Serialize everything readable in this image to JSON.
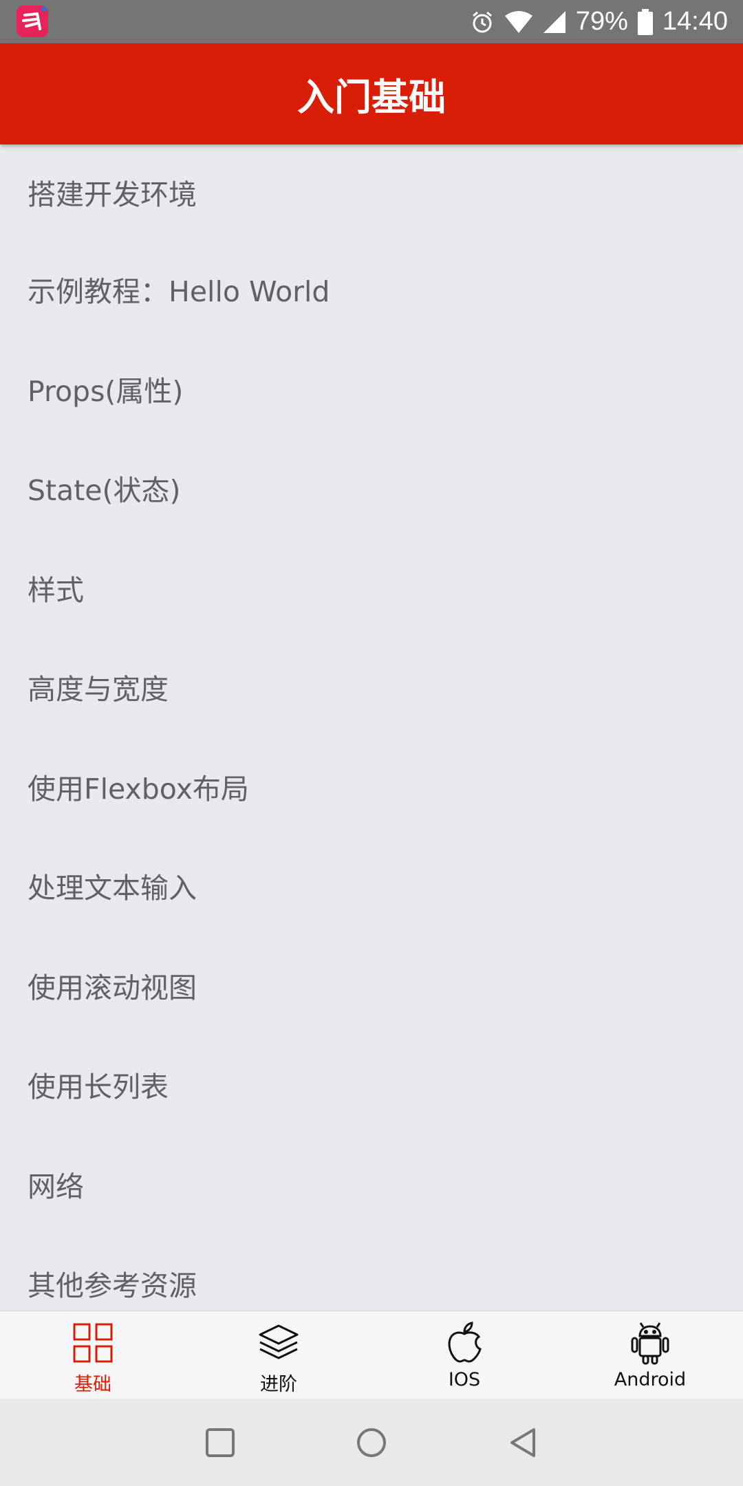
{
  "status_bar": {
    "battery": "79%",
    "time": "14:40",
    "icons": [
      "app-badge-icon",
      "alarm-icon",
      "wifi-icon",
      "cell-signal-icon",
      "battery-icon"
    ]
  },
  "app_bar": {
    "title": "入门基础"
  },
  "list": {
    "items": [
      "搭建开发环境",
      "示例教程：Hello World",
      "Props(属性)",
      "State(状态)",
      "样式",
      "高度与宽度",
      "使用Flexbox布局",
      "处理文本输入",
      "使用滚动视图",
      "使用长列表",
      "网络",
      "其他参考资源"
    ]
  },
  "tab_bar": {
    "active": 0,
    "tabs": [
      {
        "label": "基础",
        "icon": "grid-icon"
      },
      {
        "label": "进阶",
        "icon": "layers-icon"
      },
      {
        "label": "IOS",
        "icon": "apple-icon"
      },
      {
        "label": "Android",
        "icon": "android-icon"
      }
    ]
  },
  "nav_bar": {
    "buttons": [
      "recents-button",
      "home-button",
      "back-button"
    ]
  },
  "colors": {
    "accent": "#d81e06",
    "status_bar": "#757575",
    "background": "#e9e8ee",
    "text": "#606066"
  }
}
